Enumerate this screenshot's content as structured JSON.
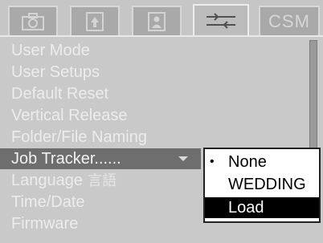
{
  "tabs": [
    {
      "icon": "camera-icon"
    },
    {
      "icon": "image-icon"
    },
    {
      "icon": "person-icon"
    },
    {
      "icon": "custom-settings-icon",
      "active": true
    },
    {
      "label": "CSM"
    }
  ],
  "menu": {
    "items": [
      {
        "label": "User Mode"
      },
      {
        "label": "User Setups"
      },
      {
        "label": "Default Reset"
      },
      {
        "label": "Vertical Release"
      },
      {
        "label": "Folder/File Naming"
      },
      {
        "label": "Job Tracker......",
        "selected": true
      },
      {
        "label": "Language",
        "glyph": "言語"
      },
      {
        "label": "Time/Date"
      },
      {
        "label": "Firmware"
      }
    ]
  },
  "submenu": {
    "items": [
      {
        "label": "None",
        "bullet": "•"
      },
      {
        "label": "WEDDING"
      },
      {
        "label": "Load",
        "highlighted": true
      }
    ]
  },
  "colors": {
    "background": "#c9c9c9",
    "selected_row": "#6e6e6e",
    "highlight": "#000000"
  }
}
